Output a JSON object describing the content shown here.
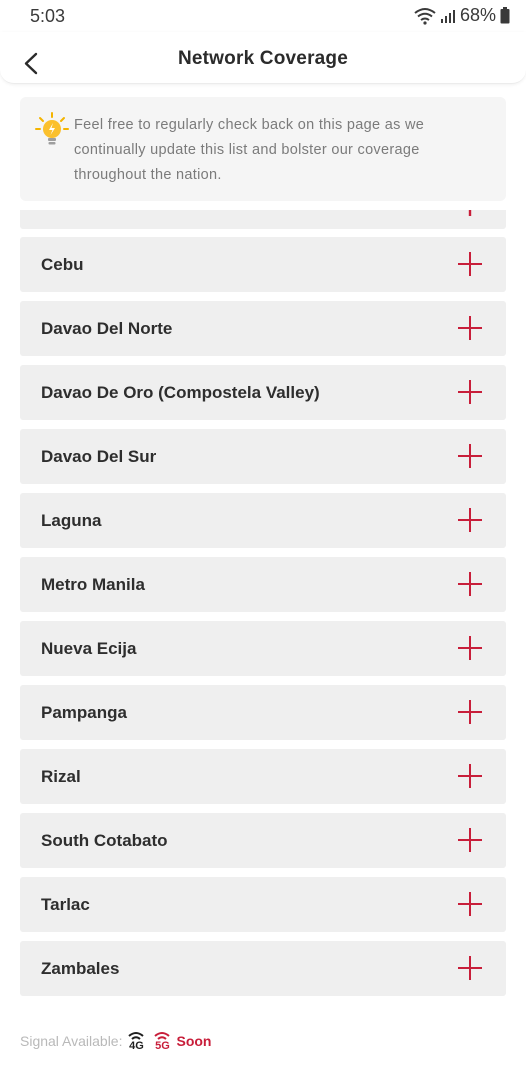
{
  "status_bar": {
    "time": "5:03",
    "battery": "68%"
  },
  "header": {
    "title": "Network Coverage"
  },
  "notice": {
    "icon": "lightbulb-icon",
    "text": "Feel free to regularly check back on this page as we continually update this list and bolster our coverage throughout the nation."
  },
  "regions": [
    {
      "label": "Cebu"
    },
    {
      "label": "Davao Del Norte"
    },
    {
      "label": "Davao De Oro (Compostela Valley)"
    },
    {
      "label": "Davao Del Sur"
    },
    {
      "label": "Laguna"
    },
    {
      "label": "Metro Manila"
    },
    {
      "label": "Nueva Ecija"
    },
    {
      "label": "Pampanga"
    },
    {
      "label": "Rizal"
    },
    {
      "label": "South Cotabato"
    },
    {
      "label": "Tarlac"
    },
    {
      "label": "Zambales"
    }
  ],
  "legend": {
    "label": "Signal Available:",
    "signal_4g": "4G",
    "signal_5g": "5G",
    "soon": "Soon"
  },
  "colors": {
    "accent": "#c81e3a",
    "row_background": "#efefef",
    "notice_background": "#f5f5f5"
  }
}
